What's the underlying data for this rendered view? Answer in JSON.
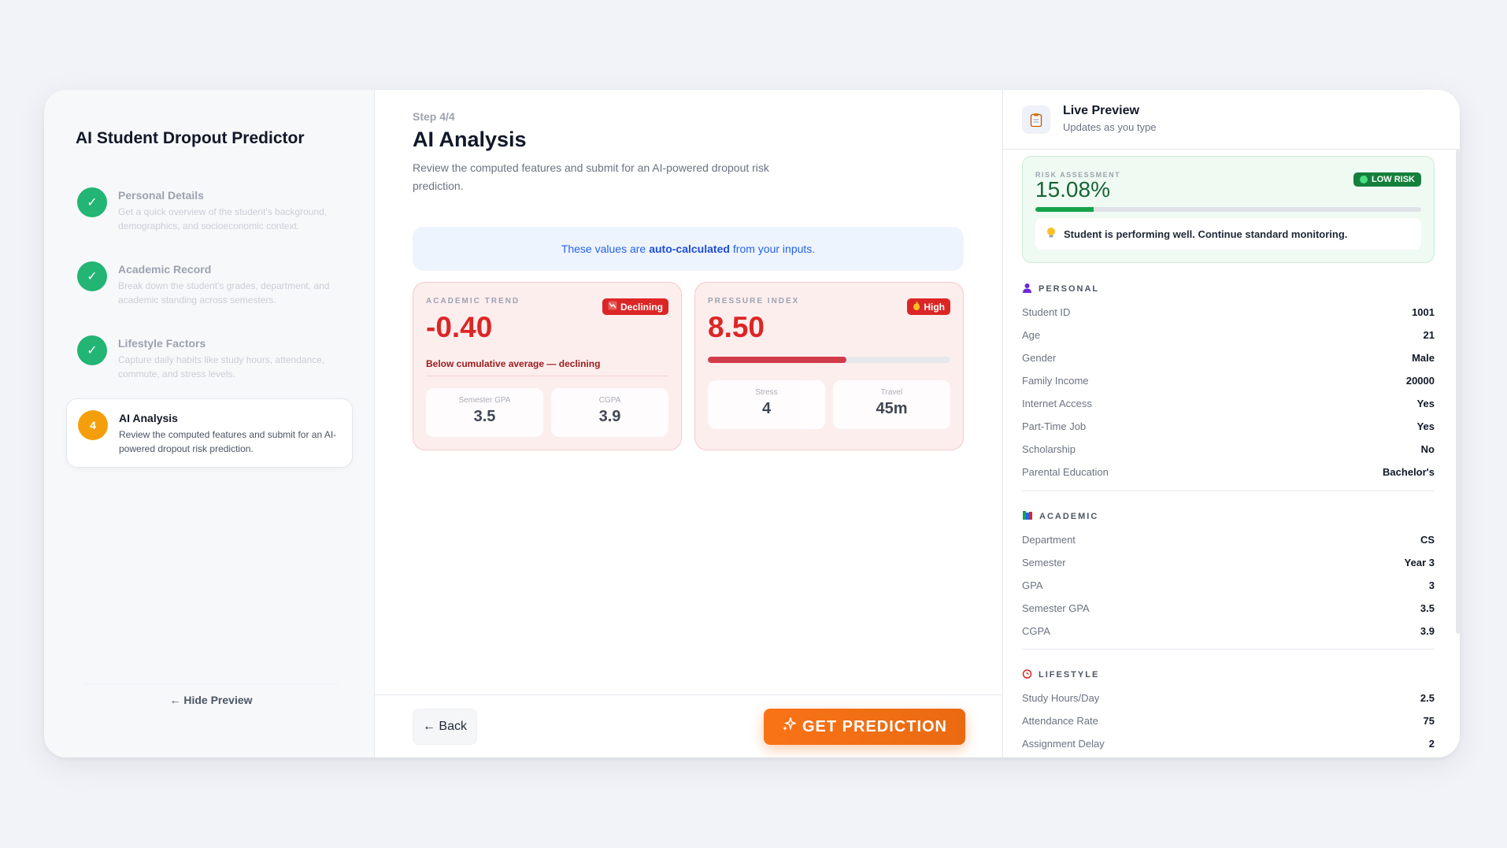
{
  "sidebar": {
    "app_title": "AI Student Dropout Predictor",
    "steps": [
      {
        "number": "✓",
        "title": "Personal Details",
        "desc": "Get a quick overview of the student's background, demographics, and socioeconomic context.",
        "status": "done"
      },
      {
        "number": "✓",
        "title": "Academic Record",
        "desc": "Break down the student's grades, department, and academic standing across semesters.",
        "status": "done"
      },
      {
        "number": "✓",
        "title": "Lifestyle Factors",
        "desc": "Capture daily habits like study hours, attendance, commute, and stress levels.",
        "status": "done"
      },
      {
        "number": "4",
        "title": "AI Analysis",
        "desc": "Review the computed features and submit for an AI-powered dropout risk prediction.",
        "status": "active"
      }
    ],
    "hide_preview": "← Hide Preview"
  },
  "main": {
    "step_label": "Step 4/4",
    "title": "AI Analysis",
    "description": "Review the computed features and submit for an AI-powered dropout risk prediction.",
    "banner": {
      "pre": "These values are",
      "bold": "auto-calculated",
      "post": "from your inputs."
    },
    "academic_trend": {
      "label": "ACADEMIC TREND",
      "tag": "Declining",
      "value": "-0.40",
      "note": "Below cumulative average — declining",
      "subs": [
        {
          "label": "Semester GPA",
          "value": "3.5"
        },
        {
          "label": "CGPA",
          "value": "3.9"
        }
      ]
    },
    "pressure_index": {
      "label": "PRESSURE INDEX",
      "tag": "High",
      "value": "8.50",
      "level_fraction": 0.57,
      "subs": [
        {
          "label": "Stress",
          "value": "4"
        },
        {
          "label": "Travel",
          "value": "45m"
        }
      ]
    },
    "back_label": "← Back",
    "predict_label": "GET PREDICTION"
  },
  "preview": {
    "title": "Live Preview",
    "subtitle": "Updates as you type",
    "risk": {
      "label": "RISK ASSESSMENT",
      "value": "15.08%",
      "fraction": 0.1508,
      "badge": "LOW RISK",
      "message": "Student is performing well. Continue standard monitoring."
    },
    "personal": {
      "heading": "PERSONAL",
      "rows": [
        {
          "k": "Student ID",
          "v": "1001"
        },
        {
          "k": "Age",
          "v": "21"
        },
        {
          "k": "Gender",
          "v": "Male"
        },
        {
          "k": "Family Income",
          "v": "20000"
        },
        {
          "k": "Internet Access",
          "v": "Yes"
        },
        {
          "k": "Part-Time Job",
          "v": "Yes"
        },
        {
          "k": "Scholarship",
          "v": "No"
        },
        {
          "k": "Parental Education",
          "v": "Bachelor's"
        }
      ]
    },
    "academic": {
      "heading": "ACADEMIC",
      "rows": [
        {
          "k": "Department",
          "v": "CS"
        },
        {
          "k": "Semester",
          "v": "Year 3"
        },
        {
          "k": "GPA",
          "v": "3"
        },
        {
          "k": "Semester GPA",
          "v": "3.5"
        },
        {
          "k": "CGPA",
          "v": "3.9"
        }
      ]
    },
    "lifestyle": {
      "heading": "LIFESTYLE",
      "rows": [
        {
          "k": "Study Hours/Day",
          "v": "2.5"
        },
        {
          "k": "Attendance Rate",
          "v": "75"
        },
        {
          "k": "Assignment Delay",
          "v": "2"
        }
      ]
    }
  },
  "colors": {
    "accent": "#f97316",
    "danger": "#dc2626",
    "success": "#16a34a",
    "info": "#2563eb"
  }
}
